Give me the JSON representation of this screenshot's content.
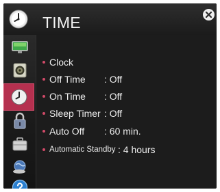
{
  "window": {
    "title": "TIME",
    "header_icon": "clock-icon",
    "close_icon": "close-icon"
  },
  "sidebar": {
    "items": [
      {
        "icon": "picture-icon",
        "selected": false
      },
      {
        "icon": "speaker-icon",
        "selected": false
      },
      {
        "icon": "clock-icon",
        "selected": true
      },
      {
        "icon": "lock-icon",
        "selected": false
      },
      {
        "icon": "briefcase-icon",
        "selected": false
      },
      {
        "icon": "network-icon",
        "selected": false
      },
      {
        "icon": "help-icon",
        "selected": false
      }
    ]
  },
  "menu": {
    "items": [
      {
        "label": "Clock",
        "value": ""
      },
      {
        "label": "Off Time",
        "value": ": Off"
      },
      {
        "label": "On Time",
        "value": ": Off"
      },
      {
        "label": "Sleep Timer",
        "value": ": Off"
      },
      {
        "label": "Auto Off",
        "value": ": 60 min."
      },
      {
        "label": "Automatic Standby",
        "value": ": 4 hours"
      }
    ]
  },
  "colors": {
    "accent": "#b5304f",
    "bullet": "#d14a68",
    "background": "#1c1c1c",
    "text": "#ededed"
  }
}
